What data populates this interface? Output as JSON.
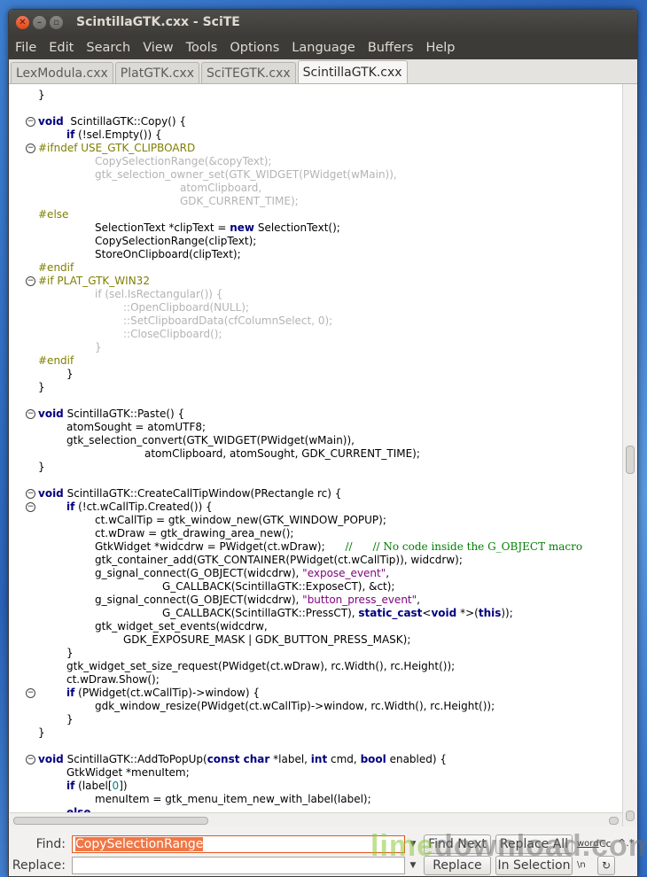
{
  "window": {
    "title": "ScintillaGTK.cxx - SciTE"
  },
  "menubar": [
    "File",
    "Edit",
    "Search",
    "View",
    "Tools",
    "Options",
    "Language",
    "Buffers",
    "Help"
  ],
  "tabs": [
    {
      "label": "LexModula.cxx",
      "active": false
    },
    {
      "label": "PlatGTK.cxx",
      "active": false
    },
    {
      "label": "SciTEGTK.cxx",
      "active": false
    },
    {
      "label": "ScintillaGTK.cxx",
      "active": true
    }
  ],
  "editor": {
    "lines": [
      {
        "fold": "",
        "text": "}",
        "indent": 0
      },
      {
        "fold": "",
        "text": "",
        "indent": 0
      },
      {
        "fold": "minus",
        "indent": 0,
        "parts": [
          [
            "kw",
            "void"
          ],
          [
            "",
            "  ScintillaGTK::Copy() {"
          ]
        ]
      },
      {
        "fold": "",
        "indent": 32,
        "parts": [
          [
            "kw",
            "if"
          ],
          [
            "",
            " (!sel.Empty()) {"
          ]
        ]
      },
      {
        "fold": "minus",
        "indent": 0,
        "parts": [
          [
            "pp",
            "#ifndef USE_GTK_CLIPBOARD"
          ]
        ]
      },
      {
        "fold": "",
        "indent": 64,
        "parts": [
          [
            "dim",
            "CopySelectionRange(&copyText);"
          ]
        ]
      },
      {
        "fold": "",
        "indent": 64,
        "parts": [
          [
            "dim",
            "gtk_selection_owner_set(GTK_WIDGET(PWidget(wMain)),"
          ]
        ]
      },
      {
        "fold": "",
        "indent": 160,
        "parts": [
          [
            "dim",
            "atomClipboard,"
          ]
        ]
      },
      {
        "fold": "",
        "indent": 160,
        "parts": [
          [
            "dim",
            "GDK_CURRENT_TIME);"
          ]
        ]
      },
      {
        "fold": "",
        "indent": 0,
        "parts": [
          [
            "pp",
            "#else"
          ]
        ]
      },
      {
        "fold": "",
        "indent": 64,
        "parts": [
          [
            "",
            "SelectionText *clipText = "
          ],
          [
            "kw",
            "new"
          ],
          [
            "",
            " SelectionText();"
          ]
        ]
      },
      {
        "fold": "",
        "indent": 64,
        "parts": [
          [
            "",
            "CopySelectionRange(clipText);"
          ]
        ]
      },
      {
        "fold": "",
        "indent": 64,
        "parts": [
          [
            "",
            "StoreOnClipboard(clipText);"
          ]
        ]
      },
      {
        "fold": "",
        "indent": 0,
        "parts": [
          [
            "pp",
            "#endif"
          ]
        ]
      },
      {
        "fold": "minus",
        "indent": 0,
        "parts": [
          [
            "pp",
            "#if PLAT_GTK_WIN32"
          ]
        ]
      },
      {
        "fold": "",
        "indent": 64,
        "parts": [
          [
            "dim",
            "if (sel.IsRectangular()) {"
          ]
        ]
      },
      {
        "fold": "",
        "indent": 96,
        "parts": [
          [
            "dim",
            "::OpenClipboard(NULL);"
          ]
        ]
      },
      {
        "fold": "",
        "indent": 96,
        "parts": [
          [
            "dim",
            "::SetClipboardData(cfColumnSelect, 0);"
          ]
        ]
      },
      {
        "fold": "",
        "indent": 96,
        "parts": [
          [
            "dim",
            "::CloseClipboard();"
          ]
        ]
      },
      {
        "fold": "",
        "indent": 64,
        "parts": [
          [
            "dim",
            "}"
          ]
        ]
      },
      {
        "fold": "",
        "indent": 0,
        "parts": [
          [
            "pp",
            "#endif"
          ]
        ]
      },
      {
        "fold": "",
        "indent": 32,
        "parts": [
          [
            "",
            "}"
          ]
        ]
      },
      {
        "fold": "",
        "indent": 0,
        "parts": [
          [
            "",
            "}"
          ]
        ]
      },
      {
        "fold": "",
        "indent": 0,
        "parts": []
      },
      {
        "fold": "minus",
        "indent": 0,
        "parts": [
          [
            "kw",
            "void"
          ],
          [
            "",
            " ScintillaGTK::Paste() {"
          ]
        ]
      },
      {
        "fold": "",
        "indent": 32,
        "parts": [
          [
            "",
            "atomSought = atomUTF8;"
          ]
        ]
      },
      {
        "fold": "",
        "indent": 32,
        "parts": [
          [
            "",
            "gtk_selection_convert(GTK_WIDGET(PWidget(wMain)),"
          ]
        ]
      },
      {
        "fold": "",
        "indent": 120,
        "parts": [
          [
            "",
            "atomClipboard, atomSought, GDK_CURRENT_TIME);"
          ]
        ]
      },
      {
        "fold": "",
        "indent": 0,
        "parts": [
          [
            "",
            "}"
          ]
        ]
      },
      {
        "fold": "",
        "indent": 0,
        "parts": []
      },
      {
        "fold": "minus",
        "indent": 0,
        "parts": [
          [
            "kw",
            "void"
          ],
          [
            "",
            " ScintillaGTK::CreateCallTipWindow(PRectangle rc) {"
          ]
        ]
      },
      {
        "fold": "minus",
        "indent": 32,
        "parts": [
          [
            "kw",
            "if"
          ],
          [
            "",
            " (!ct.wCallTip.Created()) {"
          ]
        ]
      },
      {
        "fold": "",
        "indent": 64,
        "parts": [
          [
            "",
            "ct.wCallTip = gtk_window_new(GTK_WINDOW_POPUP);"
          ]
        ]
      },
      {
        "fold": "",
        "indent": 64,
        "parts": [
          [
            "",
            "ct.wDraw = gtk_drawing_area_new();"
          ]
        ]
      },
      {
        "fold": "",
        "indent": 64,
        "parts": [
          [
            "",
            "GtkWidget *widcdrw = PWidget(ct.wDraw);      "
          ],
          [
            "cm",
            "//      // No code inside the G_OBJECT macro"
          ]
        ]
      },
      {
        "fold": "",
        "indent": 64,
        "parts": [
          [
            "",
            "gtk_container_add(GTK_CONTAINER(PWidget(ct.wCallTip)), widcdrw);"
          ]
        ]
      },
      {
        "fold": "",
        "indent": 64,
        "parts": [
          [
            "",
            "g_signal_connect(G_OBJECT(widcdrw), "
          ],
          [
            "str",
            "\"expose_event\""
          ],
          [
            "",
            ","
          ]
        ]
      },
      {
        "fold": "",
        "indent": 140,
        "parts": [
          [
            "",
            "G_CALLBACK(ScintillaGTK::ExposeCT), &ct);"
          ]
        ]
      },
      {
        "fold": "",
        "indent": 64,
        "parts": [
          [
            "",
            "g_signal_connect(G_OBJECT(widcdrw), "
          ],
          [
            "str",
            "\"button_press_event\""
          ],
          [
            "",
            ","
          ]
        ]
      },
      {
        "fold": "",
        "indent": 140,
        "parts": [
          [
            "",
            "G_CALLBACK(ScintillaGTK::PressCT), "
          ],
          [
            "kw",
            "static_cast"
          ],
          [
            "",
            "<"
          ],
          [
            "kw",
            "void"
          ],
          [
            "",
            " *>("
          ],
          [
            "kw",
            "this"
          ],
          [
            "",
            "));"
          ]
        ]
      },
      {
        "fold": "",
        "indent": 64,
        "parts": [
          [
            "",
            "gtk_widget_set_events(widcdrw,"
          ]
        ]
      },
      {
        "fold": "",
        "indent": 96,
        "parts": [
          [
            "",
            "GDK_EXPOSURE_MASK | GDK_BUTTON_PRESS_MASK);"
          ]
        ]
      },
      {
        "fold": "",
        "indent": 32,
        "parts": [
          [
            "",
            "}"
          ]
        ]
      },
      {
        "fold": "",
        "indent": 32,
        "parts": [
          [
            "",
            "gtk_widget_set_size_request(PWidget(ct.wDraw), rc.Width(), rc.Height());"
          ]
        ]
      },
      {
        "fold": "",
        "indent": 32,
        "parts": [
          [
            "",
            "ct.wDraw.Show();"
          ]
        ]
      },
      {
        "fold": "minus",
        "indent": 32,
        "parts": [
          [
            "kw",
            "if"
          ],
          [
            "",
            " (PWidget(ct.wCallTip)->window) {"
          ]
        ]
      },
      {
        "fold": "",
        "indent": 64,
        "parts": [
          [
            "",
            "gdk_window_resize(PWidget(ct.wCallTip)->window, rc.Width(), rc.Height());"
          ]
        ]
      },
      {
        "fold": "",
        "indent": 32,
        "parts": [
          [
            "",
            "}"
          ]
        ]
      },
      {
        "fold": "",
        "indent": 0,
        "parts": [
          [
            "",
            "}"
          ]
        ]
      },
      {
        "fold": "",
        "indent": 0,
        "parts": []
      },
      {
        "fold": "minus",
        "indent": 0,
        "parts": [
          [
            "kw",
            "void"
          ],
          [
            "",
            " ScintillaGTK::AddToPopUp("
          ],
          [
            "kw",
            "const char"
          ],
          [
            "",
            " *label, "
          ],
          [
            "kw",
            "int"
          ],
          [
            "",
            " cmd, "
          ],
          [
            "kw",
            "bool"
          ],
          [
            "",
            " enabled) {"
          ]
        ]
      },
      {
        "fold": "",
        "indent": 32,
        "parts": [
          [
            "",
            "GtkWidget *menuItem;"
          ]
        ]
      },
      {
        "fold": "",
        "indent": 32,
        "parts": [
          [
            "kw",
            "if"
          ],
          [
            "",
            " (label["
          ],
          [
            "num",
            "0"
          ],
          [
            "",
            "])"
          ]
        ]
      },
      {
        "fold": "",
        "indent": 64,
        "parts": [
          [
            "",
            "menuItem = gtk_menu_item_new_with_label(label);"
          ]
        ]
      },
      {
        "fold": "",
        "indent": 32,
        "parts": [
          [
            "kw",
            "else"
          ]
        ]
      }
    ]
  },
  "find": {
    "find_label": "Find:",
    "find_value": "CopySelectionRange",
    "replace_label": "Replace:",
    "replace_value": "",
    "find_next": "Find Next",
    "replace_all": "Replace All",
    "replace": "Replace",
    "in_selection": "In Selection",
    "opt_word": "word",
    "opt_case": "Cc",
    "opt_regex": "^.*",
    "opt_backslash": "\\n",
    "opt_wrap": "↻"
  },
  "watermark": {
    "part1": "lime",
    "part2": "download",
    "part3": ".com"
  }
}
